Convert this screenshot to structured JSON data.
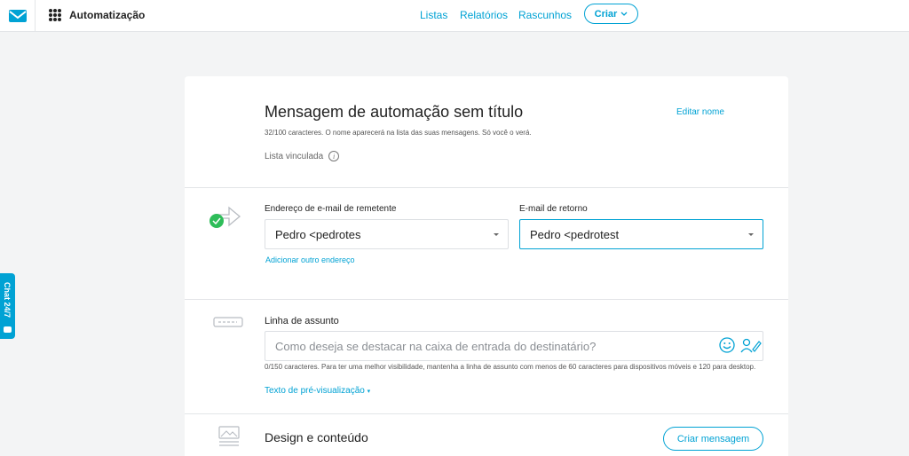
{
  "topbar": {
    "app_title": "Automatização",
    "nav": [
      "Listas",
      "Relatórios",
      "Rascunhos"
    ],
    "create_label": "Criar"
  },
  "chat": {
    "label": "Chat 24/7"
  },
  "header_section": {
    "title": "Mensagem de automação sem título",
    "edit_name": "Editar nome",
    "hint": "32/100 caracteres. O nome aparecerá na lista das suas mensagens. Só você o verá.",
    "linked_list": "Lista vinculada"
  },
  "sender_section": {
    "from_label": "Endereço de e-mail de remetente",
    "from_value": "Pedro <pedrotes",
    "reply_label": "E-mail de retorno",
    "reply_value": "Pedro <pedrotest",
    "add_address": "Adicionar outro endereço"
  },
  "subject_section": {
    "label": "Linha de assunto",
    "placeholder": "Como deseja se destacar na caixa de entrada do destinatário?",
    "hint": "0/150 caracteres. Para ter uma melhor visibilidade, mantenha a linha de assunto com menos de 60 caracteres para dispositivos móveis e 120 para desktop.",
    "preview_link": "Texto de pré-visualização"
  },
  "design_section": {
    "title": "Design e conteúdo",
    "create_button": "Criar mensagem"
  },
  "colors": {
    "accent": "#00a2d4",
    "success": "#2ebd59"
  }
}
